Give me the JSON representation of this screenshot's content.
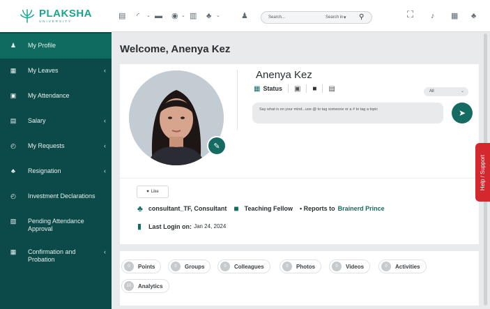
{
  "brand": {
    "name": "PLAKSHA",
    "sub": "UNIVERSITY"
  },
  "sidebar": {
    "items": [
      {
        "label": "My Profile",
        "icon": "person-icon",
        "glyph": "♟",
        "chevron": ""
      },
      {
        "label": "My Leaves",
        "icon": "calendar-icon",
        "glyph": "▦",
        "chevron": "‹"
      },
      {
        "label": "My Attendance",
        "icon": "calendar-check-icon",
        "glyph": "▣",
        "chevron": ""
      },
      {
        "label": "Salary",
        "icon": "money-icon",
        "glyph": "▤",
        "chevron": "‹"
      },
      {
        "label": "My Requests",
        "icon": "request-icon",
        "glyph": "◴",
        "chevron": "‹"
      },
      {
        "label": "Resignation",
        "icon": "user-remove-icon",
        "glyph": "♣",
        "chevron": "‹"
      },
      {
        "label": "Investment Declarations",
        "icon": "investment-icon",
        "glyph": "◴",
        "chevron": ""
      },
      {
        "label": "Pending Attendance Approval",
        "icon": "approval-icon",
        "glyph": "▨",
        "chevron": ""
      },
      {
        "label": "Confirmation and Probation",
        "icon": "grid-icon",
        "glyph": "▦",
        "chevron": "‹"
      }
    ]
  },
  "topbar": {
    "search_placeholder": "Search...",
    "search_in": "Search in",
    "icons": [
      "id-card-icon",
      "rss-icon",
      "folder-icon",
      "info-icon",
      "chart-icon",
      "org-icon",
      "person-icon",
      "scan-icon",
      "bell-icon",
      "calendar-icon",
      "team-icon"
    ]
  },
  "main": {
    "welcome": "Welcome, Anenya Kez",
    "profile": {
      "name": "Anenya Kez",
      "post_tabs": {
        "status": "Status"
      },
      "audience": "All",
      "composer_placeholder": "Say what is on your mind...use @ to tag someone or a # to tag a topic",
      "like_label": "Like",
      "role": "consultant_TF, Consultant",
      "designation": "Teaching Fellow",
      "reports_to_label": "• Reports to",
      "reports_to": "Brainerd Prince",
      "last_login_label": "Last Login on:",
      "last_login": "Jan 24, 2024"
    },
    "stats": [
      {
        "count": "0",
        "label": "Points"
      },
      {
        "count": "0",
        "label": "Groups"
      },
      {
        "count": "0",
        "label": "Colleagues"
      },
      {
        "count": "0",
        "label": "Photos"
      },
      {
        "count": "0",
        "label": "Videos"
      },
      {
        "count": "0",
        "label": "Activities"
      },
      {
        "count": "10",
        "label": "Analytics"
      }
    ]
  },
  "help": {
    "label": "Help / Support"
  },
  "colors": {
    "sidebar": "#0b4a49",
    "accent": "#156b62",
    "help": "#d4282f"
  }
}
